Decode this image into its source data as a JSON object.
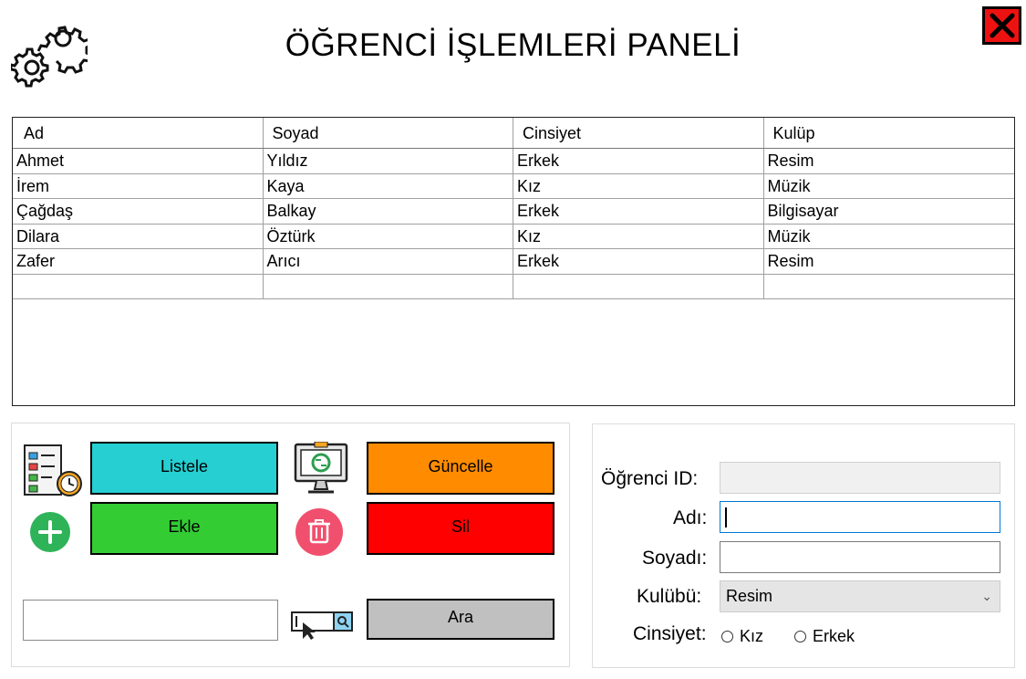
{
  "header": {
    "title": "ÖĞRENCİ İŞLEMLERİ PANELİ",
    "close_color": "#ee1111"
  },
  "grid": {
    "columns": [
      "Ad",
      "Soyad",
      "Cinsiyet",
      "Kulüp"
    ],
    "rows": [
      [
        "Ahmet",
        "Yıldız",
        "Erkek",
        "Resim"
      ],
      [
        "İrem",
        "Kaya",
        "Kız",
        "Müzik"
      ],
      [
        "Çağdaş",
        "Balkay",
        "Erkek",
        "Bilgisayar"
      ],
      [
        "Dilara",
        "Öztürk",
        "Kız",
        "Müzik"
      ],
      [
        "Zafer",
        "Arıcı",
        "Erkek",
        "Resim"
      ],
      [
        "",
        "",
        "",
        ""
      ]
    ]
  },
  "buttons": {
    "listele": "Listele",
    "guncelle": "Güncelle",
    "ekle": "Ekle",
    "sil": "Sil",
    "ara": "Ara"
  },
  "search": {
    "value": ""
  },
  "form": {
    "ogrenci_id_label": "Öğrenci ID:",
    "ad_label": "Adı:",
    "soyad_label": "Soyadı:",
    "kulup_label": "Kulübü:",
    "cinsiyet_label": "Cinsiyet:",
    "kulup_selected": "Resim",
    "radio_kiz": "Kız",
    "radio_erkek": "Erkek"
  },
  "colors": {
    "listele": "#25cfd2",
    "guncelle": "#ff8c00",
    "ekle": "#33cc33",
    "sil": "#ff0000",
    "ara": "#c0c0c0"
  }
}
